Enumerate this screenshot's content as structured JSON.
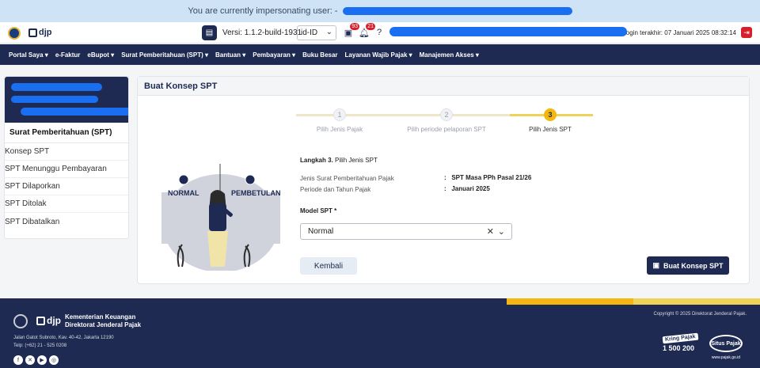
{
  "impersonation": {
    "text": "You are currently impersonating user: -"
  },
  "topbar": {
    "version_label": "Versi:",
    "version_value": "1.1.2-build-1931",
    "language": "id-ID",
    "notif_badge": "93",
    "alert_badge": "21",
    "last_login": "Login terakhir:  07 Januari 2025 08:32:14",
    "logo_text": "djp"
  },
  "nav": {
    "items": [
      "Portal Saya ▾",
      "e-Faktur",
      "eBupot ▾",
      "Surat Pemberitahuan (SPT) ▾",
      "Bantuan ▾",
      "Pembayaran ▾",
      "Buku Besar",
      "Layanan Wajib Pajak ▾",
      "Manajemen Akses ▾"
    ]
  },
  "sidebar": {
    "title": "Surat Pemberitahuan (SPT)",
    "items": [
      "Konsep SPT",
      "SPT Menunggu Pembayaran",
      "SPT Dilaporkan",
      "SPT Ditolak",
      "SPT Dibatalkan"
    ]
  },
  "main": {
    "title": "Buat Konsep SPT",
    "steps": [
      {
        "num": "1",
        "label": "Pilih Jenis Pajak"
      },
      {
        "num": "2",
        "label": "Pilih periode pelaporan SPT"
      },
      {
        "num": "3",
        "label": "Pilih Jenis SPT"
      }
    ],
    "step_heading": "Langkah 3.",
    "step_heading_sub": "Pilih Jenis SPT",
    "jenis_label": "Jenis Surat Pemberitahuan Pajak",
    "jenis_value": "SPT Masa PPh Pasal 21/26",
    "periode_label": "Periode dan Tahun Pajak",
    "periode_value": "Januari 2025",
    "model_label": "Model SPT *",
    "model_value": "Normal",
    "btn_back": "Kembali",
    "btn_create": "Buat Konsep SPT",
    "illus_left": "NORMAL",
    "illus_right": "PEMBETULAN"
  },
  "footer": {
    "djp": "djp",
    "org_line1": "Kementerian Keuangan",
    "org_line2": "Direktorat Jenderal Pajak",
    "address": "Jalan Gatot Subroto, Kav. 40-42, Jakarta 12190",
    "phone": "Telp: (+62) 21 - 525 0208",
    "copyright": "Copyright © 2025 Direktorat Jenderal Pajak.",
    "kring_label": "Kring Pajak",
    "kring_number": "1 500 200",
    "situs_label": "Situs Pajak",
    "situs_url": "www.pajak.go.id"
  },
  "colors": {
    "primary": "#1e2a52",
    "accent": "#f3b70f",
    "redaction": "#1a6ff0"
  }
}
